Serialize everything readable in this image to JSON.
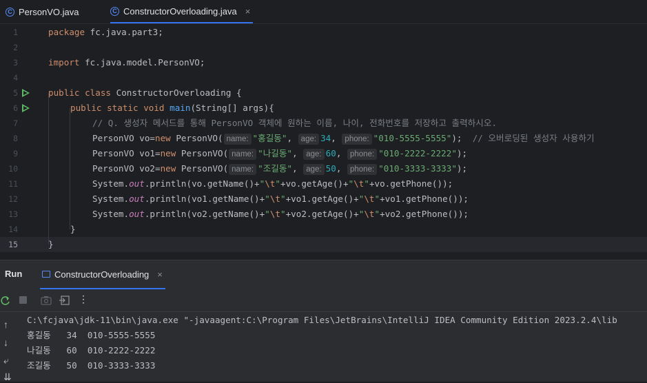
{
  "tabs": [
    {
      "label": "PersonVO.java",
      "active": false
    },
    {
      "label": "ConstructorOverloading.java",
      "active": true
    }
  ],
  "editor": {
    "line_numbers": [
      "1",
      "2",
      "3",
      "4",
      "5",
      "6",
      "7",
      "8",
      "9",
      "10",
      "11",
      "12",
      "13",
      "14",
      "15"
    ],
    "current_line": "15",
    "code": {
      "l1_kw": "package",
      "l1_rest": " fc.java.part3;",
      "l3_kw": "import",
      "l3_rest": " fc.java.model.PersonVO;",
      "l5_kw1": "public",
      "l5_kw2": "class",
      "l5_name": "ConstructorOverloading",
      "l5_brace": "{",
      "l6_kw1": "public",
      "l6_kw2": "static",
      "l6_kw3": "void",
      "l6_fn": "main",
      "l6_rest": "(String[] args){",
      "l7_comment": "// Q. 생성자 메서드를 통해 PersonVO 객체에 원하는 이름, 나이, 전화번호를 저장하고 출력하시오.",
      "l8_a": "PersonVO vo=",
      "l8_new": "new",
      "l8_b": " PersonVO(",
      "l8_h1": "name:",
      "l8_s1": "\"홍길동\"",
      "l8_c1": ",",
      "l8_h2": "age:",
      "l8_n": "34",
      "l8_c2": ",",
      "l8_h3": "phone:",
      "l8_s2": "\"010-5555-5555\"",
      "l8_end": ");",
      "l8_comment": "// 오버로딩된 생성자 사용하기",
      "l9_a": "PersonVO vo1=",
      "l9_new": "new",
      "l9_b": " PersonVO(",
      "l9_h1": "name:",
      "l9_s1": "\"나길동\"",
      "l9_c1": ",",
      "l9_h2": "age:",
      "l9_n": "60",
      "l9_c2": ",",
      "l9_h3": "phone:",
      "l9_s2": "\"010-2222-2222\"",
      "l9_end": ");",
      "l10_a": "PersonVO vo2=",
      "l10_new": "new",
      "l10_b": " PersonVO(",
      "l10_h1": "name:",
      "l10_s1": "\"조길동\"",
      "l10_c1": ",",
      "l10_h2": "age:",
      "l10_n": "50",
      "l10_c2": ",",
      "l10_h3": "phone:",
      "l10_s2": "\"010-3333-3333\"",
      "l10_end": ");",
      "l11_a": "System.",
      "l11_out": "out",
      "l11_b": ".println(vo.getName()+",
      "l11_q1": "\"",
      "l11_t1": "\\t",
      "l11_q2": "\"",
      "l11_c": "+vo.getAge()+",
      "l11_q3": "\"",
      "l11_t2": "\\t",
      "l11_q4": "\"",
      "l11_d": "+vo.getPhone());",
      "l12_a": "System.",
      "l12_out": "out",
      "l12_b": ".println(vo1.getName()+",
      "l12_q1": "\"",
      "l12_t1": "\\t",
      "l12_q2": "\"",
      "l12_c": "+vo1.getAge()+",
      "l12_q3": "\"",
      "l12_t2": "\\t",
      "l12_q4": "\"",
      "l12_d": "+vo1.getPhone());",
      "l13_a": "System.",
      "l13_out": "out",
      "l13_b": ".println(vo2.getName()+",
      "l13_q1": "\"",
      "l13_t1": "\\t",
      "l13_q2": "\"",
      "l13_c": "+vo2.getAge()+",
      "l13_q3": "\"",
      "l13_t2": "\\t",
      "l13_q4": "\"",
      "l13_d": "+vo2.getPhone());",
      "l14": "}",
      "l15": "}"
    }
  },
  "run_panel": {
    "title": "Run",
    "tab_label": "ConstructorOverloading",
    "console_lines": [
      "C:\\fcjava\\jdk-11\\bin\\java.exe \"-javaagent:C:\\Program Files\\JetBrains\\IntelliJ IDEA Community Edition 2023.2.4\\lib",
      "홍길동   34  010-5555-5555",
      "나길동   60  010-2222-2222",
      "조길동   50  010-3333-3333"
    ]
  },
  "icons": {
    "tab_class": "C",
    "close": "×",
    "more": "⋮",
    "up": "↑",
    "down": "↓",
    "wrap": "⤶",
    "scroll_end": "⇊"
  },
  "colors": {
    "background": "#1e1f22",
    "panel": "#2b2d30",
    "keyword": "#cf8e6d",
    "string": "#6aab73",
    "number": "#2aacb8",
    "comment": "#7a7e85",
    "function": "#56a8f5",
    "static_field": "#c77dbb",
    "accent": "#3574f0"
  }
}
